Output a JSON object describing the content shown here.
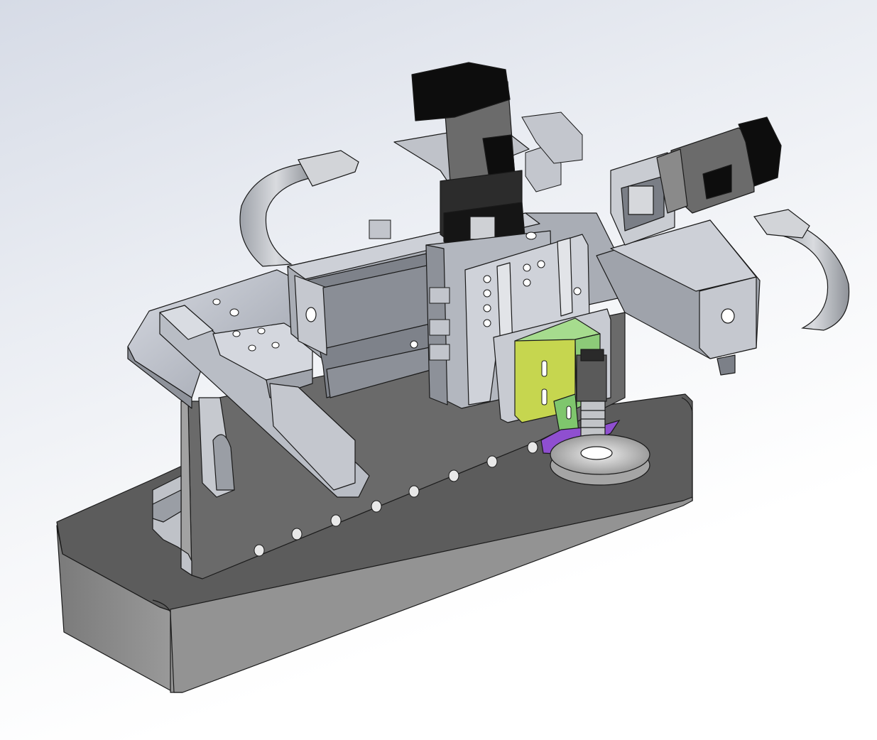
{
  "viewport": {
    "background_top": "#d6dbe6",
    "background_bottom": "#ffffff"
  },
  "model": {
    "colors": {
      "base_front": "#8d8d8d",
      "base_top": "#5e5e5e",
      "plate_light": "#c9cdd6",
      "plate_mid": "#a9adb6",
      "plate_dark": "#7c8088",
      "rail": "#b8bcc4",
      "motor": "#0d0d0d",
      "motor_body": "#6b6b6b",
      "bracket_yellow": "#c6d64f",
      "bracket_green": "#9ed68a",
      "purple": "#8f4fd0",
      "cable_chain": "#b9bcc2",
      "edge": "#1a1a1a"
    }
  }
}
